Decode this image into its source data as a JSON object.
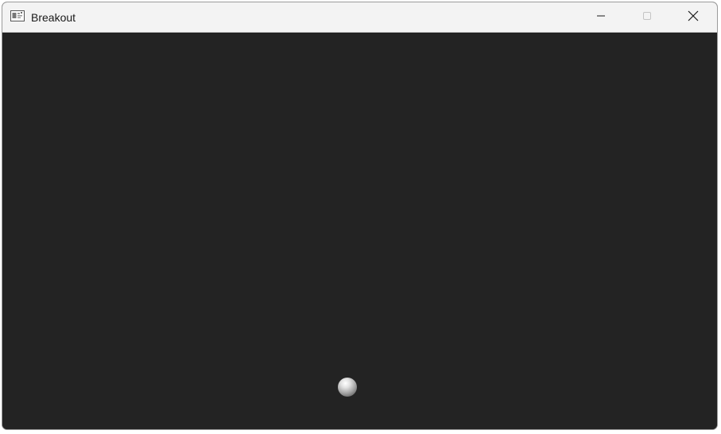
{
  "window": {
    "title": "Breakout",
    "app_icon": "window-app-icon",
    "controls": {
      "minimize_icon": "minimize-icon",
      "maximize_icon": "maximize-icon",
      "close_icon": "close-icon"
    }
  },
  "game": {
    "background_color": "#232323",
    "ball_icon": "ball"
  }
}
